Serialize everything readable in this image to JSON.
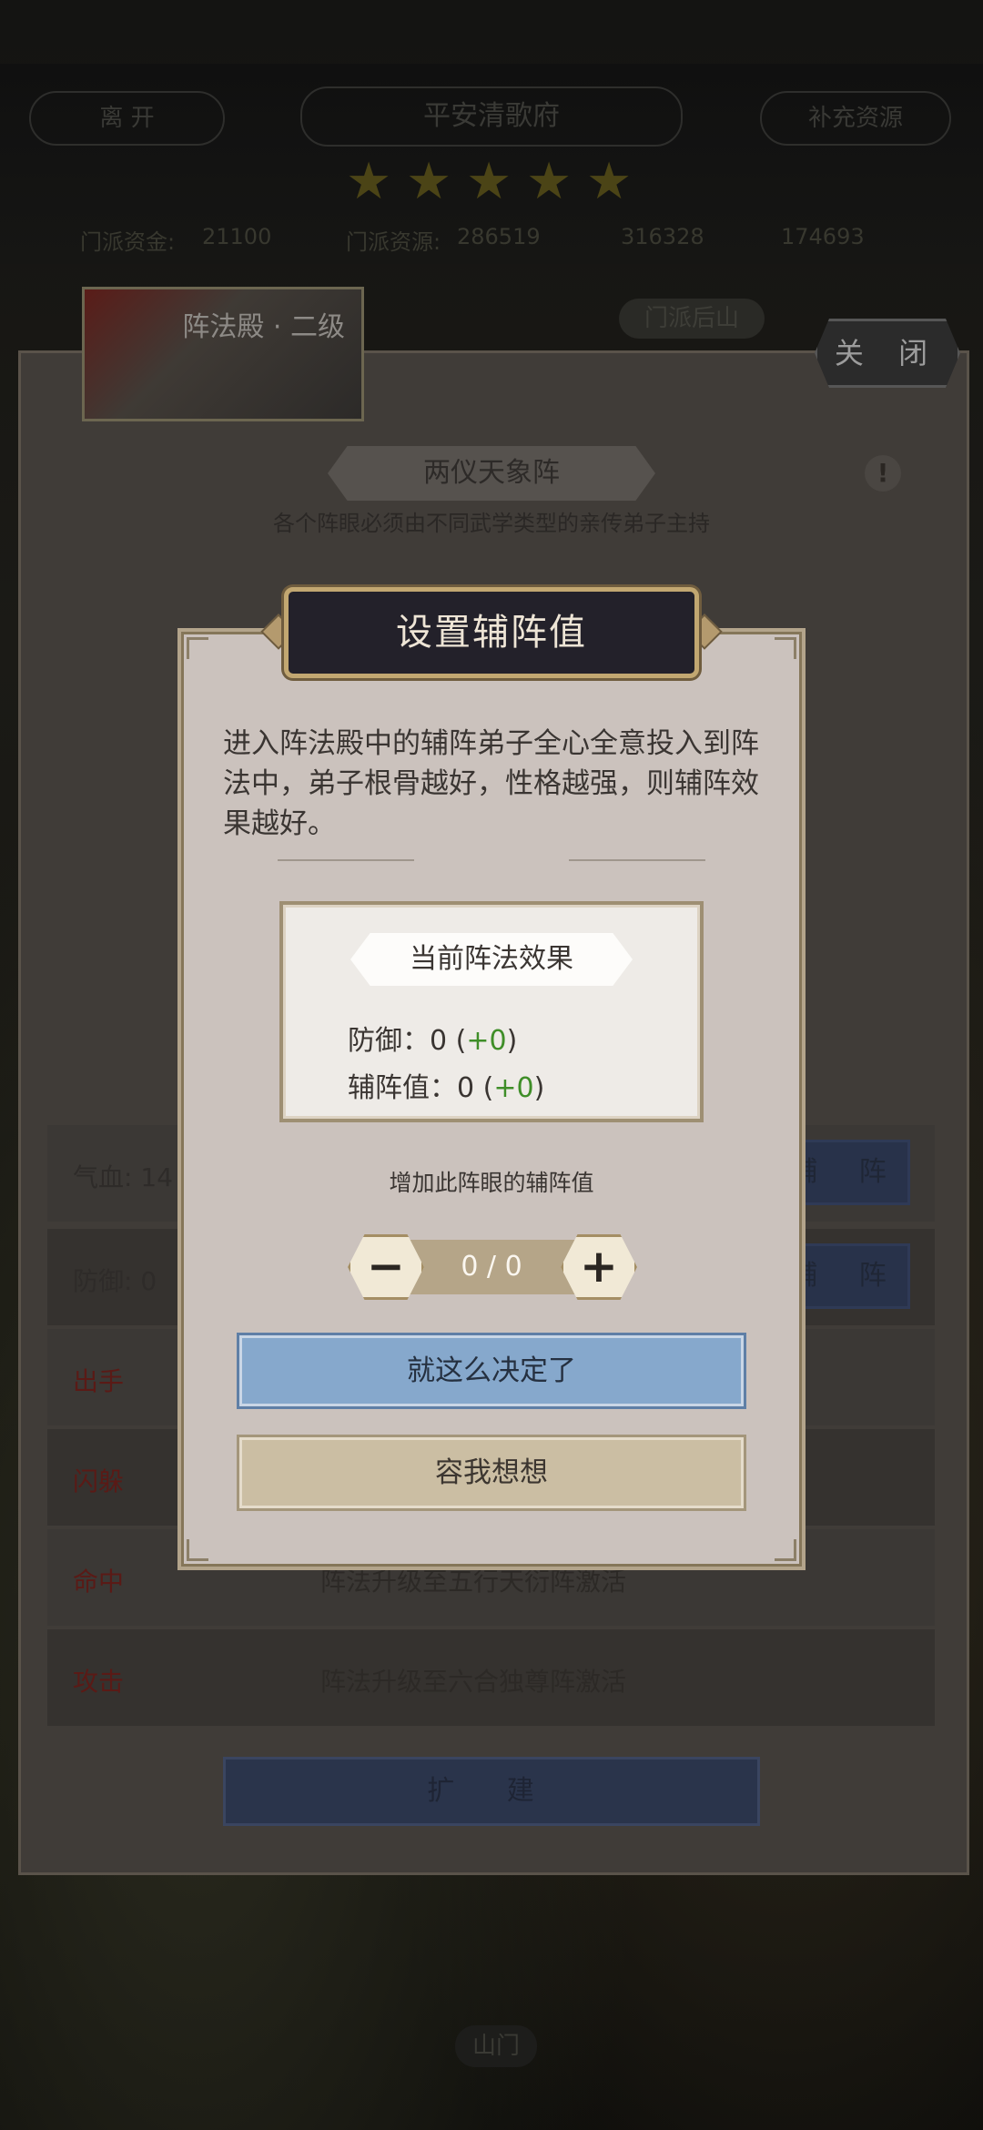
{
  "header": {
    "leave_label": "离 开",
    "sect_name": "平安清歌府",
    "resupply_label": "补充资源",
    "stars": 5,
    "sect_funds_label": "门派资金:",
    "sect_funds_value": "21100",
    "sect_resources_label": "门派资源:",
    "sect_resources_value": "286519",
    "resource_2": "316328",
    "resource_3": "174693"
  },
  "hall": {
    "thumb_label": "阵法殿 · 二级",
    "back_hill": "门派后山",
    "close_label": "关 闭",
    "formation_name": "两仪天象阵",
    "formation_hint": "各个阵眼必须由不同武学类型的亲传弟子主持",
    "info_icon": "!",
    "rows": [
      {
        "label": "气血: 14",
        "hint": ""
      },
      {
        "label": "防御: 0",
        "hint": ""
      },
      {
        "label": "出手",
        "hint": ""
      },
      {
        "label": "闪躲",
        "hint": ""
      },
      {
        "label": "命中",
        "hint": "阵法升级至五行天衍阵激活"
      },
      {
        "label": "攻击",
        "hint": "阵法升级至六合独尊阵激活"
      }
    ],
    "assist_label": "辅 阵",
    "expand_label": "扩 建",
    "mountain_gate": "山门"
  },
  "modal": {
    "title": "设置辅阵值",
    "description": "进入阵法殿中的辅阵弟子全心全意投入到阵法中，弟子根骨越好，性格越强，则辅阵效果越好。",
    "effect_title": "当前阵法效果",
    "defense_label": "防御：0 (",
    "defense_delta": "+0",
    "assist_label": "辅阵值：0 (",
    "assist_delta": "+0",
    "close_paren": ")",
    "increase_label": "增加此阵眼的辅阵值",
    "stepper_value": "0 / 0",
    "minus_glyph": "−",
    "plus_glyph": "+",
    "confirm_label": "就这么决定了",
    "cancel_label": "容我想想"
  },
  "colors": {
    "accent_green": "#3f8e28",
    "confirm_blue": "#86a8cc",
    "title_bg": "#23212a",
    "gold_border": "#c2a771"
  }
}
